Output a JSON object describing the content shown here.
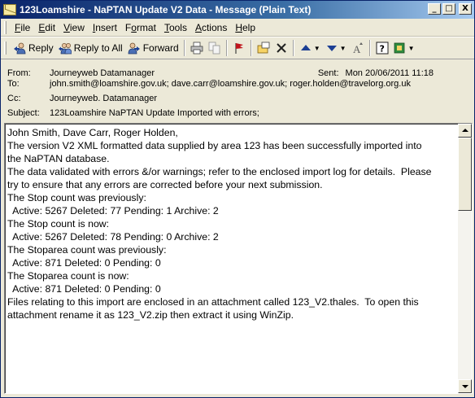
{
  "window": {
    "title": "123Loamshire - NaPTAN Update V2 Data - Message (Plain Text)",
    "controls": {
      "minimize": "_",
      "maximize": "□",
      "close": "X"
    }
  },
  "menu": {
    "items": [
      {
        "key": "F",
        "rest": "ile"
      },
      {
        "key": "E",
        "rest": "dit"
      },
      {
        "key": "V",
        "rest": "iew"
      },
      {
        "key": "I",
        "rest": "nsert"
      },
      {
        "pre": "F",
        "key": "o",
        "rest": "rmat"
      },
      {
        "key": "T",
        "rest": "ools"
      },
      {
        "key": "A",
        "rest": "ctions"
      },
      {
        "key": "H",
        "rest": "elp"
      }
    ]
  },
  "toolbar": {
    "reply": "Reply",
    "reply_all": "Reply to All",
    "forward": "Forward",
    "accent_color": "#1c3f94",
    "flag_color": "#c0141c"
  },
  "header": {
    "from_label": "From:",
    "from": "Journeyweb Datamanager",
    "sent_label": "Sent:",
    "sent": "Mon 20/06/2011 11:18",
    "to_label": "To:",
    "to": "john.smith@loamshire.gov.uk; dave.carr@loamshire.gov.uk; roger.holden@travelorg.org.uk",
    "cc_label": "Cc:",
    "cc": "Journeyweb. Datamanager",
    "subject_label": "Subject:",
    "subject": "123Loamshire NaPTAN Update Imported with errors;"
  },
  "body": {
    "lines": [
      "John Smith, Dave Carr, Roger Holden,",
      "",
      "The version V2 XML formatted data supplied by area 123 has been successfully imported into",
      "the NaPTAN database.",
      "",
      "The data validated with errors &/or warnings; refer to the enclosed import log for details.  Please",
      "try to ensure that any errors are corrected before your next submission.",
      "",
      "The Stop count was previously:",
      "  Active: 5267 Deleted: 77 Pending: 1 Archive: 2",
      "The Stop count is now:",
      "  Active: 5267 Deleted: 78 Pending: 0 Archive: 2",
      "",
      "The Stoparea count was previously:",
      "  Active: 871 Deleted: 0 Pending: 0",
      "The Stoparea count is now:",
      "  Active: 871 Deleted: 0 Pending: 0",
      "",
      "Files relating to this import are enclosed in an attachment called 123_V2.thales.  To open this",
      "attachment rename it as 123_V2.zip then extract it using WinZip."
    ]
  }
}
